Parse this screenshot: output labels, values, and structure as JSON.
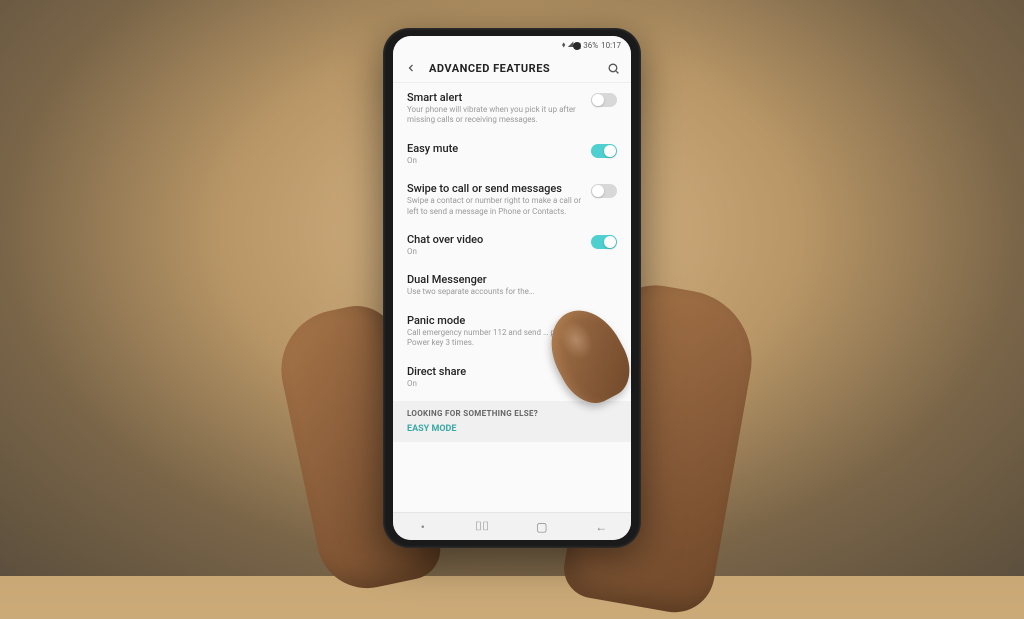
{
  "statusbar": {
    "signal": "⬧ ◢",
    "battery": "▮ 36%",
    "time": "10:17"
  },
  "appbar": {
    "title": "ADVANCED FEATURES"
  },
  "items": [
    {
      "label": "Smart alert",
      "sub": "Your phone will vibrate when you pick it up after missing calls or receiving messages.",
      "on": false
    },
    {
      "label": "Easy mute",
      "sub": "On",
      "on": true
    },
    {
      "label": "Swipe to call or send messages",
      "sub": "Swipe a contact or number right to make a call or left to send a message in Phone or Contacts.",
      "on": false
    },
    {
      "label": "Chat over video",
      "sub": "On",
      "on": true
    },
    {
      "label": "Dual Messenger",
      "sub": "Use two separate accounts for the…",
      "on": null
    },
    {
      "label": "Panic mode",
      "sub": "Call emergency number 112 and send … pressing the Power key 3 times.",
      "on": null
    },
    {
      "label": "Direct share",
      "sub": "On",
      "on": true
    }
  ],
  "footer": {
    "label": "LOOKING FOR SOMETHING ELSE?",
    "link": "EASY MODE"
  }
}
